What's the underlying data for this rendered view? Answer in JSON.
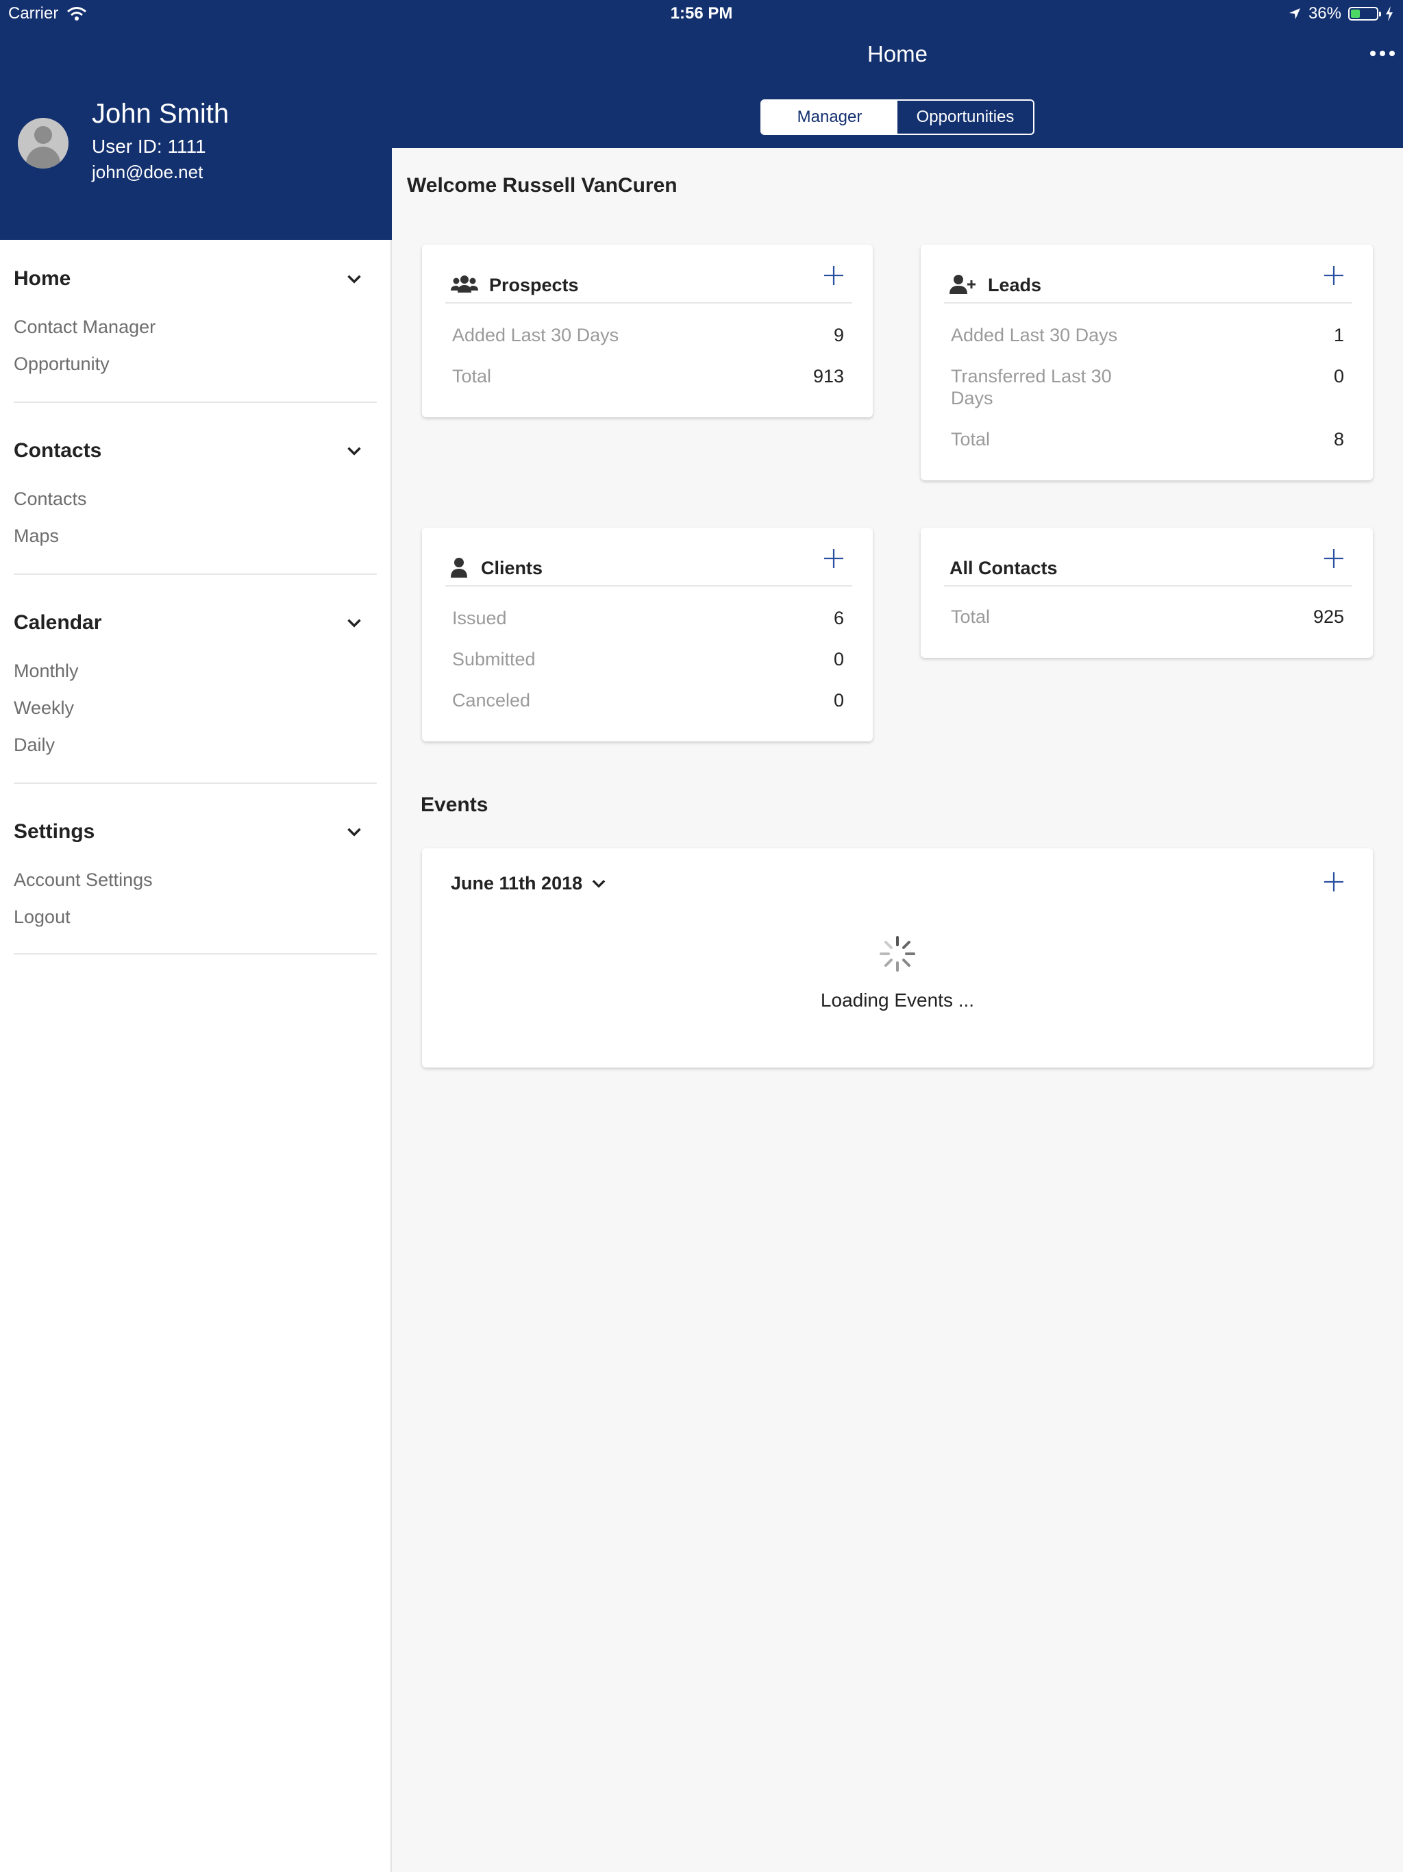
{
  "status_bar": {
    "carrier": "Carrier",
    "time": "1:56 PM",
    "battery": "36%",
    "battery_level": 0.36
  },
  "profile": {
    "name": "John Smith",
    "user_id": "User ID: 1111",
    "email": "john@doe.net"
  },
  "sidebar": {
    "sections": [
      {
        "title": "Home",
        "items": [
          "Contact Manager",
          "Opportunity"
        ]
      },
      {
        "title": "Contacts",
        "items": [
          "Contacts",
          "Maps"
        ]
      },
      {
        "title": "Calendar",
        "items": [
          "Monthly",
          "Weekly",
          "Daily"
        ]
      },
      {
        "title": "Settings",
        "items": [
          "Account Settings",
          "Logout"
        ]
      }
    ]
  },
  "header": {
    "title": "Home",
    "segments": [
      "Manager",
      "Opportunities"
    ],
    "active_segment": "Manager"
  },
  "main": {
    "welcome": "Welcome Russell VanCuren",
    "cards": {
      "prospects": {
        "title": "Prospects",
        "rows": [
          {
            "label": "Added Last 30 Days",
            "value": "9"
          },
          {
            "label": "Total",
            "value": "913"
          }
        ]
      },
      "leads": {
        "title": "Leads",
        "rows": [
          {
            "label": "Added Last 30 Days",
            "value": "1"
          },
          {
            "label": "Transferred Last 30",
            "label2": "Days",
            "value": "0"
          },
          {
            "label": "Total",
            "value": "8"
          }
        ]
      },
      "clients": {
        "title": "Clients",
        "rows": [
          {
            "label": "Issued",
            "value": "6"
          },
          {
            "label": "Submitted",
            "value": "0"
          },
          {
            "label": "Canceled",
            "value": "0"
          }
        ]
      },
      "all_contacts": {
        "title": "All Contacts",
        "rows": [
          {
            "label": "Total",
            "value": "925"
          }
        ]
      }
    },
    "events": {
      "title": "Events",
      "date": "June 11th 2018",
      "loading": "Loading Events ..."
    }
  },
  "colors": {
    "navy": "#13306f",
    "accent_blue": "#2a4fa0"
  }
}
